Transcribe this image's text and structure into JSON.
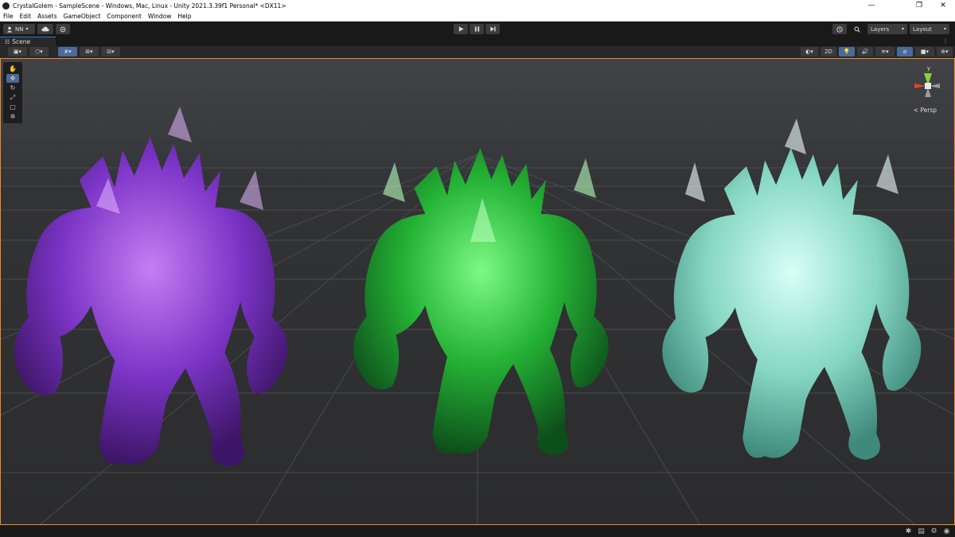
{
  "window": {
    "title": "CrystalGolem - SampleScene - Windows, Mac, Linux - Unity 2021.3.39f1 Personal* <DX11>",
    "minimize": "—",
    "maximize": "❐",
    "close": "✕"
  },
  "menu": {
    "items": [
      "File",
      "Edit",
      "Assets",
      "GameObject",
      "Component",
      "Window",
      "Help"
    ]
  },
  "toolbar": {
    "account_label": "NN",
    "layers_label": "Layers",
    "layout_label": "Layout"
  },
  "scene_tab": {
    "label": "Scene"
  },
  "scene_toolbar": {
    "two_d_label": "2D"
  },
  "gizmo": {
    "y_label": "y",
    "view_mode_label": "< Persp"
  },
  "colors": {
    "accent_orange": "#f28a26",
    "selected_blue": "#4a6a99",
    "golem_purple": "#8a3fd6",
    "golem_green": "#2fc23c",
    "golem_teal": "#7fd6c4"
  },
  "icons": {
    "toolbar": [
      "account-icon",
      "cloud-icon",
      "settings-icon",
      "play-icon",
      "pause-icon",
      "step-icon",
      "history-icon",
      "search-icon"
    ],
    "tools": [
      "hand-icon",
      "move-icon",
      "rotate-icon",
      "scale-icon",
      "rect-icon",
      "transform-icon"
    ],
    "status": [
      "bug-icon",
      "message-icon",
      "settings-icon",
      "notification-icon"
    ]
  }
}
